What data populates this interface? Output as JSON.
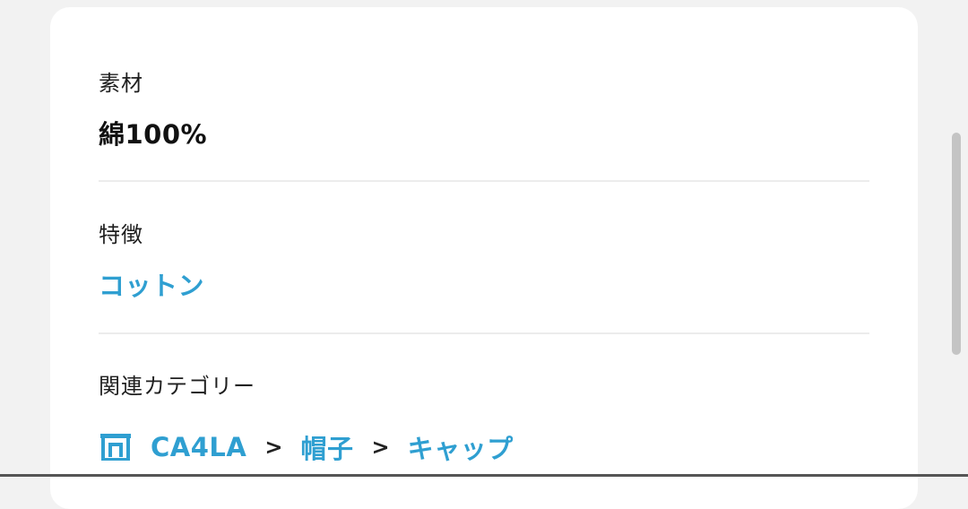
{
  "material": {
    "label": "素材",
    "value": "綿100%"
  },
  "features": {
    "label": "特徴",
    "value": "コットン"
  },
  "related_categories": {
    "label": "関連カテゴリー",
    "breadcrumb": [
      "CA4LA",
      "帽子",
      "キャップ"
    ],
    "separator": ">"
  },
  "icons": {
    "store": "store-icon"
  },
  "colors": {
    "link": "#2f9fd1",
    "background": "#f2f2f2",
    "card": "#ffffff"
  }
}
